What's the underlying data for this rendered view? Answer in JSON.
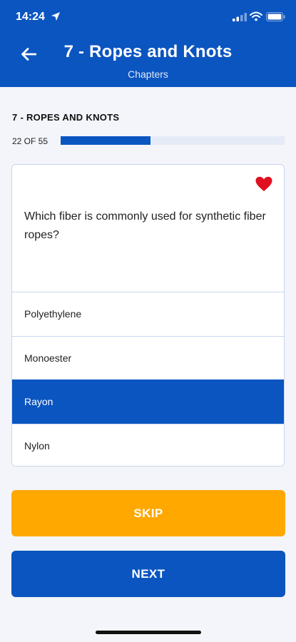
{
  "status_bar": {
    "time": "14:24",
    "icons": [
      "location-arrow-icon",
      "signal-icon",
      "wifi-icon",
      "battery-icon"
    ]
  },
  "header": {
    "title": "7 - Ropes and Knots",
    "subtitle": "Chapters",
    "back_icon": "back-arrow-icon",
    "background_color": "#0b55c0"
  },
  "quiz": {
    "section_label": "7 - ROPES AND KNOTS",
    "progress_text": "22 OF 55",
    "progress_fraction": 0.4,
    "favorite_icon": "heart-icon",
    "favorite_color": "#e01020",
    "question": "Which fiber is commonly used for synthetic fiber ropes?",
    "answers": [
      {
        "label": "Polyethylene",
        "selected": false
      },
      {
        "label": "Monoester",
        "selected": false
      },
      {
        "label": "Rayon",
        "selected": true
      },
      {
        "label": "Nylon",
        "selected": false
      }
    ]
  },
  "buttons": {
    "skip_label": "SKIP",
    "skip_color": "#ffa800",
    "next_label": "NEXT",
    "next_color": "#0b55c0"
  }
}
